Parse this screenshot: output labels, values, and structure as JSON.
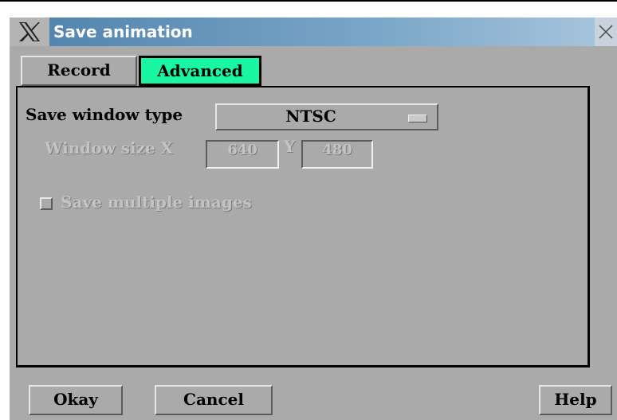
{
  "window": {
    "title": "Save animation",
    "close_glyph": "✕"
  },
  "tabs": [
    {
      "label": "Record",
      "active": false
    },
    {
      "label": "Advanced",
      "active": true
    }
  ],
  "colors": {
    "active_tab": "#19f7a3",
    "panel": "#aaaaaa"
  },
  "advanced": {
    "save_window_type_label": "Save window type",
    "save_window_type_value": "NTSC",
    "window_size_label": "Window size X",
    "window_size_x": "640",
    "y_label": "Y",
    "window_size_y": "480",
    "save_multiple_images_label": "Save multiple images",
    "save_multiple_images_checked": false
  },
  "buttons": {
    "okay": "Okay",
    "cancel": "Cancel",
    "help": "Help"
  }
}
